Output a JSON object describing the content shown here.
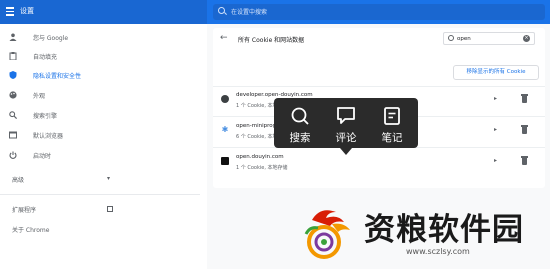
{
  "app": {
    "title": "设置"
  },
  "search": {
    "placeholder": "在设置中搜索"
  },
  "sidebar": {
    "items": [
      {
        "label": "您与 Google",
        "icon": "person-icon"
      },
      {
        "label": "自动填充",
        "icon": "clipboard-icon"
      },
      {
        "label": "隐私设置和安全性",
        "icon": "shield-icon",
        "active": true
      },
      {
        "label": "外观",
        "icon": "palette-icon"
      },
      {
        "label": "搜索引擎",
        "icon": "search-icon"
      },
      {
        "label": "默认浏览器",
        "icon": "browser-icon"
      },
      {
        "label": "启动时",
        "icon": "power-icon"
      }
    ],
    "advanced": "高级",
    "extensions": "扩展程序",
    "about": "关于 Chrome"
  },
  "main": {
    "title": "所有 Cookie 和网站数据",
    "filter_value": "open",
    "remove_all_button": "移除显示的所有 Cookie",
    "sites": [
      {
        "name": "developer.open-douyin.com",
        "detail": "1 个 Cookie, 本地存储",
        "icon_color": "#3c4043"
      },
      {
        "name": "open-miniprogram.douyin.com",
        "detail": "6 个 Cookie, 本地存储",
        "icon_color": "#4a90e2"
      },
      {
        "name": "open.douyin.com",
        "detail": "1 个 Cookie, 本地存储",
        "icon_color": "#111111"
      }
    ]
  },
  "popup": {
    "search": "搜索",
    "comment": "评论",
    "note": "笔记"
  },
  "watermark": {
    "brand": "资粮软件园",
    "url": "www.sczlsy.com"
  },
  "colors": {
    "accent": "#1a73e8",
    "topbar": "#1a73e8",
    "popup_bg": "#2b2b2b"
  }
}
